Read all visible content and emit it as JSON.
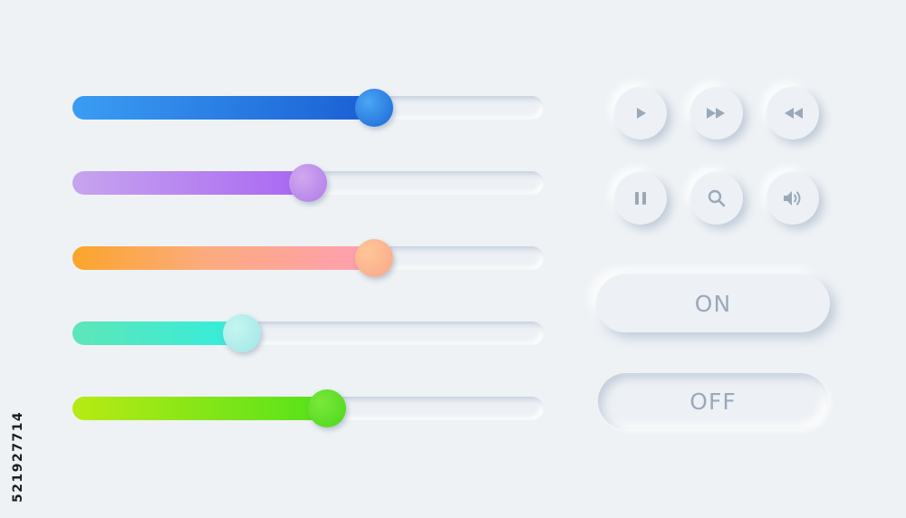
{
  "sliders": [
    {
      "id": "blue",
      "value": 0.64,
      "fill": "linear-gradient(90deg,#3a9df3 0%,#1a5fd4 100%)",
      "thumb": "radial-gradient(circle at 35% 35%,#4aa6f4,#1b66d6)"
    },
    {
      "id": "purple",
      "value": 0.5,
      "fill": "linear-gradient(90deg,#c7a4ef 0%,#a866f2 100%)",
      "thumb": "radial-gradient(circle at 35% 35%,#d0a8f0,#b07ae9)"
    },
    {
      "id": "orange",
      "value": 0.64,
      "fill": "linear-gradient(90deg,#fba52b 0%,#fcab80 45%,#ff9fb2 100%)",
      "thumb": "radial-gradient(circle at 35% 35%,#fdc796,#fca58c)"
    },
    {
      "id": "teal",
      "value": 0.36,
      "fill": "linear-gradient(90deg,#5ee6b8 0%,#34eddc 100%)",
      "thumb": "radial-gradient(circle at 35% 35%,#c6f5f0,#9fe6e6)"
    },
    {
      "id": "green",
      "value": 0.54,
      "fill": "linear-gradient(90deg,#b8ea14 0%,#54e21a 100%)",
      "thumb": "radial-gradient(circle at 35% 35%,#7ae83a,#4cd61d)"
    }
  ],
  "media_buttons": [
    {
      "icon": "play-icon"
    },
    {
      "icon": "fast-forward-icon"
    },
    {
      "icon": "rewind-icon"
    },
    {
      "icon": "pause-icon"
    },
    {
      "icon": "search-icon"
    },
    {
      "icon": "volume-icon"
    }
  ],
  "toggles": {
    "on_label": "ON",
    "off_label": "OFF"
  },
  "icon_color": "#9aa9ba",
  "stock_id": "521927714"
}
